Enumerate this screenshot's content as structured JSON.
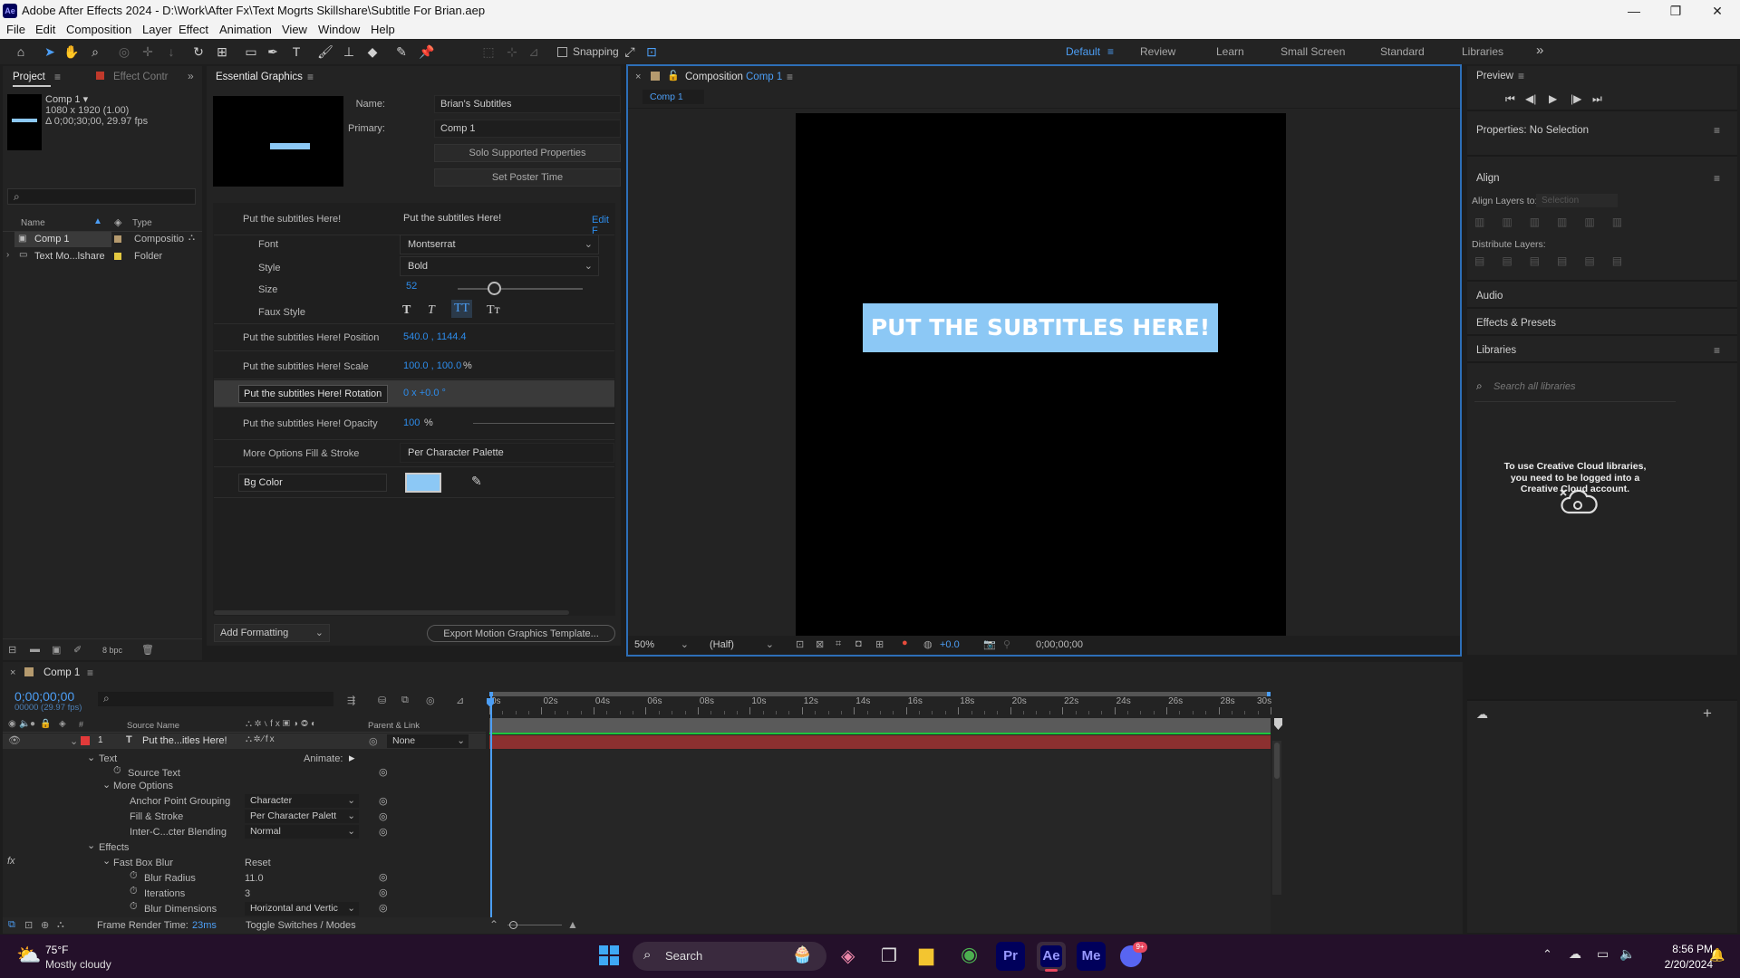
{
  "window": {
    "app_icon": "Ae",
    "title": "Adobe After Effects 2024 - D:\\Work\\After Fx\\Text Mogrts Skillshare\\Subtitle For Brian.aep",
    "controls": [
      "—",
      "❐",
      "✕"
    ]
  },
  "menu": [
    "File",
    "Edit",
    "Composition",
    "Layer",
    "Effect",
    "Animation",
    "View",
    "Window",
    "Help"
  ],
  "toolbar": {
    "snapping_label": "Snapping",
    "workspaces": [
      "Default",
      "Review",
      "Learn",
      "Small Screen",
      "Standard",
      "Libraries"
    ],
    "active_workspace": "Default",
    "more": "»"
  },
  "project": {
    "tab": "Project",
    "tab2": "Effect Contr",
    "comp_name": "Comp 1 ▾",
    "comp_res": "1080 x 1920 (1.00)",
    "comp_dur": "Δ 0;00;30;00, 29.97 fps",
    "search_icon": "⌕",
    "col_name": "Name",
    "col_type": "Type",
    "items": [
      {
        "name": "Comp 1",
        "type": "Compositio",
        "color": "#b59a6e"
      },
      {
        "name": "Text Mo...lshare",
        "type": "Folder",
        "color": "#e3c840"
      }
    ],
    "bpc": "8 bpc"
  },
  "essential_graphics": {
    "tab": "Essential Graphics",
    "name_label": "Name:",
    "name_value": "Brian's Subtitles",
    "primary_label": "Primary:",
    "primary_value": "Comp 1",
    "solo_button": "Solo Supported Properties",
    "poster_button": "Set Poster Time",
    "text_prop_label": "Put the subtitles Here!",
    "text_prop_value": "Put the subtitles Here!",
    "edit_link": "Edit F",
    "font_label": "Font",
    "font_value": "Montserrat",
    "style_label": "Style",
    "style_value": "Bold",
    "size_label": "Size",
    "size_value": "52",
    "size_level": 0.3,
    "faux_label": "Faux Style",
    "faux_buttons": [
      "T",
      "T",
      "TT",
      "Tт"
    ],
    "position_label": "Put the subtitles Here! Position",
    "position_value": "540.0 , 1144.4",
    "scale_label": "Put the subtitles Here! Scale",
    "scale_value": "100.0 , 100.0",
    "scale_unit": "%",
    "rotation_label": "Put the subtitles Here! Rotation",
    "rotation_value": "0 x +0.0 °",
    "opacity_label": "Put the subtitles Here! Opacity",
    "opacity_value": "100",
    "opacity_unit": "%",
    "more_label": "More Options Fill & Stroke",
    "more_value": "Per Character Palette",
    "bg_label": "Bg Color",
    "bg_color": "#8cc8f5",
    "add_formatting": "Add Formatting",
    "export_button": "Export Motion Graphics Template..."
  },
  "composition": {
    "tab_prefix": "Composition",
    "tab_comp": "Comp 1",
    "sub_tab": "Comp 1",
    "subtitle_text": "PUT THE SUBTITLES HERE!",
    "subtitle_bg": "#8cc8f5",
    "zoom": "50%",
    "resolution": "(Half)",
    "exposure": "+0.0",
    "timecode": "0;00;00;00"
  },
  "right_panels": {
    "preview": "Preview",
    "properties": "Properties: No Selection",
    "align": "Align",
    "align_to_label": "Align Layers to:",
    "align_to_value": "Selection",
    "distribute_label": "Distribute Layers:",
    "audio": "Audio",
    "effects_presets": "Effects & Presets",
    "libraries": "Libraries",
    "search_libraries": "Search all libraries",
    "cc_message": "To use Creative Cloud libraries, you need to be logged into a Creative Cloud account."
  },
  "timeline": {
    "tab": "Comp 1",
    "timecode": "0;00;00;00",
    "frames": "00000 (29.97 fps)",
    "col_source": "Source Name",
    "col_parent": "Parent & Link",
    "layer_num": "1",
    "layer_name": "Put the...itles Here!",
    "layer_parent": "None",
    "ruler": [
      "0s",
      "02s",
      "04s",
      "06s",
      "08s",
      "10s",
      "12s",
      "14s",
      "16s",
      "18s",
      "20s",
      "22s",
      "24s",
      "26s",
      "28s",
      "30s"
    ],
    "props": [
      {
        "label": "Text",
        "indent": 1,
        "twirl": "⌄"
      },
      {
        "label": "Source Text",
        "indent": 2,
        "stopwatch": true
      },
      {
        "label": "More Options",
        "indent": 2,
        "twirl": "⌄"
      },
      {
        "label": "Anchor Point Grouping",
        "indent": 3,
        "dropdown": "Character"
      },
      {
        "label": "Fill & Stroke",
        "indent": 3,
        "dropdown": "Per Character Palett"
      },
      {
        "label": "Inter-C...cter Blending",
        "indent": 3,
        "dropdown": "Normal"
      },
      {
        "label": "Effects",
        "indent": 1,
        "twirl": "⌄"
      },
      {
        "label": "Fast Box Blur",
        "indent": 2,
        "twirl": "⌄",
        "link": "Reset"
      },
      {
        "label": "Blur Radius",
        "indent": 3,
        "stopwatch": true,
        "value": "11.0"
      },
      {
        "label": "Iterations",
        "indent": 3,
        "stopwatch": true,
        "value": "3"
      },
      {
        "label": "Blur Dimensions",
        "indent": 3,
        "stopwatch": true,
        "dropdown": "Horizontal and Vertic"
      }
    ],
    "animate_label": "Animate:",
    "render_time_label": "Frame Render Time:",
    "render_time_value": "23ms",
    "toggle_label": "Toggle Switches / Modes"
  },
  "taskbar": {
    "temp": "75°F",
    "weather": "Mostly cloudy",
    "search": "Search",
    "time": "8:56 PM",
    "date": "2/20/2024",
    "apps": [
      {
        "label": "Pr",
        "bg": "#00005b",
        "fg": "#9999ff"
      },
      {
        "label": "Ae",
        "bg": "#00005b",
        "fg": "#9999ff"
      },
      {
        "label": "Me",
        "bg": "#00005b",
        "fg": "#9999ff"
      }
    ],
    "discord_badge": "9+"
  }
}
